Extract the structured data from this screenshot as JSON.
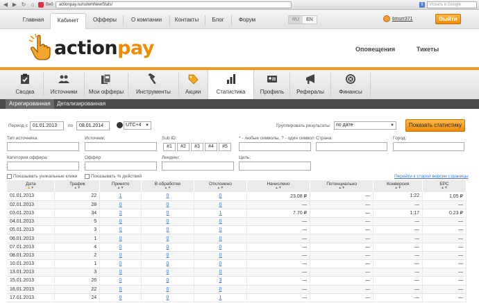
{
  "browser": {
    "tab_label": "Веб",
    "url": "actionpay.ru/ru/wmNewStats/",
    "search_placeholder": "Искать в Google",
    "search_engine_badge": "8"
  },
  "topnav": {
    "items": [
      "Главная",
      "Кабинет",
      "Офферы",
      "О компании",
      "Контакты",
      "Блог",
      "Форум"
    ],
    "active_index": 1,
    "langs": [
      "RU",
      "EN"
    ],
    "active_lang": "EN",
    "username": "timurr371",
    "logout": "Выйти"
  },
  "header": {
    "logo_part1": "action",
    "logo_part2": "pay",
    "notifications": "Оповещения",
    "tickets": "Тикеты"
  },
  "mainnav": {
    "items": [
      {
        "label": "Сводка",
        "icon": "clipboard-icon"
      },
      {
        "label": "Источники",
        "icon": "users-icon"
      },
      {
        "label": "Мои офферы",
        "icon": "documents-icon"
      },
      {
        "label": "Инструменты",
        "icon": "hammer-icon"
      },
      {
        "label": "Акции",
        "icon": "tag-icon"
      },
      {
        "label": "Статистика",
        "icon": "bar-chart-icon"
      },
      {
        "label": "Профиль",
        "icon": "id-card-icon"
      },
      {
        "label": "Рефералы",
        "icon": "megaphone-icon"
      },
      {
        "label": "Финансы",
        "icon": "coins-icon"
      }
    ],
    "active_index": 5
  },
  "subtabs": {
    "items": [
      "Агрегированная",
      "Детализированная"
    ],
    "active_index": 0
  },
  "filters": {
    "period_label": "Период с",
    "period_from": "01.01.2013",
    "period_to_label": "по",
    "period_to": "08.01.2014",
    "timezone": "UTC+4",
    "group_label": "Группировать результаты:",
    "group_value": "по дате",
    "show_button": "Показать статистику",
    "source_type_label": "Тип источника:",
    "source_label": "Источник:",
    "subid_label": "Sub ID:",
    "subid_hint": "* - любые символы, ? - один символ",
    "subid_buttons": [
      "#1",
      "#2",
      "#3",
      "#4",
      "#5"
    ],
    "country_label": "Страна:",
    "city_label": "Город:",
    "offer_category_label": "Категория оффера:",
    "offer_label": "Оффер:",
    "landing_label": "Лендинг:",
    "goal_label": "Цель:",
    "show_unique_clicks": "Показывать уникальные клики",
    "show_percent_actions": "Показывать % действий",
    "old_version_link": "Перейти к старой версии страницы"
  },
  "table": {
    "columns": [
      "Дата",
      "Трафик",
      "Принято",
      "В обработке",
      "Отклонено",
      "Начислено",
      "Потенциально",
      "Конверсия",
      "EPC"
    ],
    "rows": [
      [
        "01.01.2013",
        "22",
        "1",
        "0",
        "0",
        "23.08 ₽",
        "—",
        "1:22",
        "1.05 ₽"
      ],
      [
        "02.01.2013",
        "28",
        "0",
        "0",
        "0",
        "—",
        "—",
        "—",
        "—"
      ],
      [
        "03.01.2013",
        "34",
        "2",
        "0",
        "1",
        "7.70 ₽",
        "—",
        "1:17",
        "0.23 ₽"
      ],
      [
        "04.01.2013",
        "5",
        "0",
        "0",
        "0",
        "—",
        "—",
        "—",
        "—"
      ],
      [
        "05.01.2013",
        "3",
        "0",
        "0",
        "0",
        "—",
        "—",
        "—",
        "—"
      ],
      [
        "06.01.2013",
        "1",
        "0",
        "0",
        "0",
        "—",
        "—",
        "—",
        "—"
      ],
      [
        "07.01.2013",
        "4",
        "0",
        "0",
        "0",
        "—",
        "—",
        "—",
        "—"
      ],
      [
        "08.01.2013",
        "2",
        "0",
        "0",
        "0",
        "—",
        "—",
        "—",
        "—"
      ],
      [
        "10.01.2013",
        "1",
        "0",
        "0",
        "0",
        "—",
        "—",
        "—",
        "—"
      ],
      [
        "13.01.2013",
        "3",
        "0",
        "0",
        "0",
        "—",
        "—",
        "—",
        "—"
      ],
      [
        "15.01.2013",
        "26",
        "0",
        "0",
        "3",
        "—",
        "—",
        "—",
        "—"
      ],
      [
        "16.01.2013",
        "22",
        "0",
        "0",
        "0",
        "—",
        "—",
        "—",
        "—"
      ],
      [
        "17.01.2013",
        "24",
        "0",
        "0",
        "1",
        "—",
        "—",
        "—",
        "—"
      ]
    ]
  }
}
